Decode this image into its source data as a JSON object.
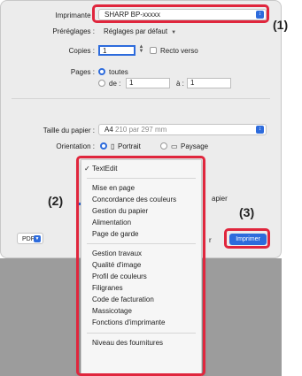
{
  "dialog": {
    "printer_label": "Imprimante :",
    "printer_value": "SHARP BP-xxxxx",
    "presets_label": "Préréglages :",
    "presets_value": "Réglages par défaut",
    "copies_label": "Copies :",
    "copies_value": "1",
    "duplex_label": "Recto verso",
    "pages_label": "Pages :",
    "pages_all": "toutes",
    "pages_from_label": "de :",
    "pages_from_value": "1",
    "pages_to_label": "à :",
    "pages_to_value": "1",
    "paper_label": "Taille du papier :",
    "paper_value": "A4",
    "paper_dims": "210 par 297 mm",
    "orientation_label": "Orientation :",
    "orientation_portrait": "Portrait",
    "orientation_landscape": "Paysage",
    "partial_right_text": "apier",
    "partial_left_text": "r",
    "pdf_label": "PDF",
    "print_button": "Imprimer"
  },
  "menu": {
    "selected": "TextEdit",
    "group1": [
      "Mise en page",
      "Concordance des couleurs",
      "Gestion du papier",
      "Alimentation",
      "Page de garde"
    ],
    "group2": [
      "Gestion travaux",
      "Qualité d'image",
      "Profil de couleurs",
      "Filigranes",
      "Code de facturation",
      "Massicotage",
      "Fonctions d'imprimante"
    ],
    "group3": [
      "Niveau des fournitures"
    ]
  },
  "callouts": {
    "c1": "(1)",
    "c2": "(2)",
    "c3": "(3)"
  },
  "colors": {
    "accent": "#2d6bdc",
    "highlight": "#e0263d",
    "dialog_bg": "#ececec"
  },
  "icons": {
    "checkmark": "checkmark-icon",
    "select_arrow": "select-arrow-icon",
    "stepper": "stepper-icon",
    "portrait": "portrait-icon",
    "landscape": "landscape-icon"
  }
}
